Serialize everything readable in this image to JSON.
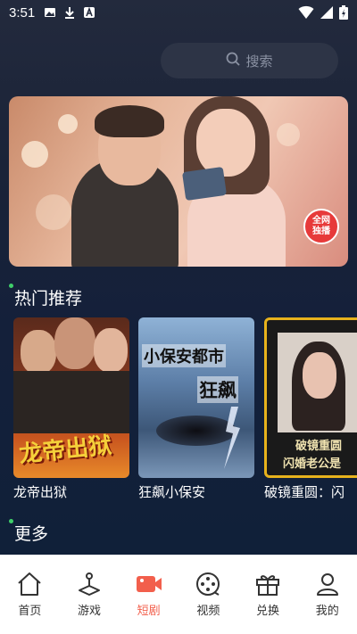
{
  "status_bar": {
    "time": "3:51",
    "icons": [
      "image-icon",
      "download-icon",
      "app-icon",
      "wifi-icon",
      "signal-icon",
      "battery-icon"
    ]
  },
  "search": {
    "placeholder": "搜索"
  },
  "banner": {
    "badge_line1": "全网",
    "badge_line2": "独播"
  },
  "hot": {
    "title": "热门推荐",
    "items": [
      {
        "caption": "龙帝出狱",
        "poster_text": "龙帝出狱"
      },
      {
        "caption": "狂飙小保安",
        "poster_text_top": "小保安都市",
        "poster_text_main": "狂飙"
      },
      {
        "caption": "破镜重圆：闪",
        "poster_text_top": "破镜重圆",
        "poster_text_bottom": "闪婚老公是"
      }
    ]
  },
  "more": {
    "title": "更多"
  },
  "bottom_nav": {
    "items": [
      {
        "label": "首页",
        "icon": "home-icon"
      },
      {
        "label": "游戏",
        "icon": "joystick-icon"
      },
      {
        "label": "短剧",
        "icon": "video-camera-icon",
        "active": true
      },
      {
        "label": "视频",
        "icon": "film-reel-icon"
      },
      {
        "label": "兑换",
        "icon": "gift-icon"
      },
      {
        "label": "我的",
        "icon": "user-icon"
      }
    ]
  },
  "colors": {
    "accent": "#f25f4c",
    "background": "#14203a",
    "nav_bg": "#ffffff"
  }
}
